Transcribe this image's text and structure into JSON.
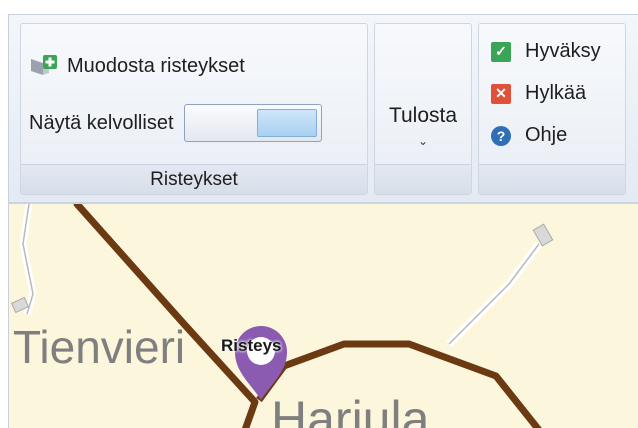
{
  "ribbon": {
    "risteykset_group": {
      "create_label": "Muodosta risteykset",
      "toggle_label": "Näytä kelvolliset",
      "footer": "Risteykset"
    },
    "print_group": {
      "label": "Tulosta",
      "chevron": "⌄"
    },
    "actions_group": {
      "approve_label": "Hyväksy",
      "reject_label": "Hylkää",
      "help_label": "Ohje"
    }
  },
  "map": {
    "place_1": "Tienvieri",
    "place_2": "Harjula",
    "pin_label": "Risteys"
  },
  "colors": {
    "road": "#6b3a12",
    "pin": "#8a5bb0",
    "map_bg": "#fcf6dc"
  }
}
